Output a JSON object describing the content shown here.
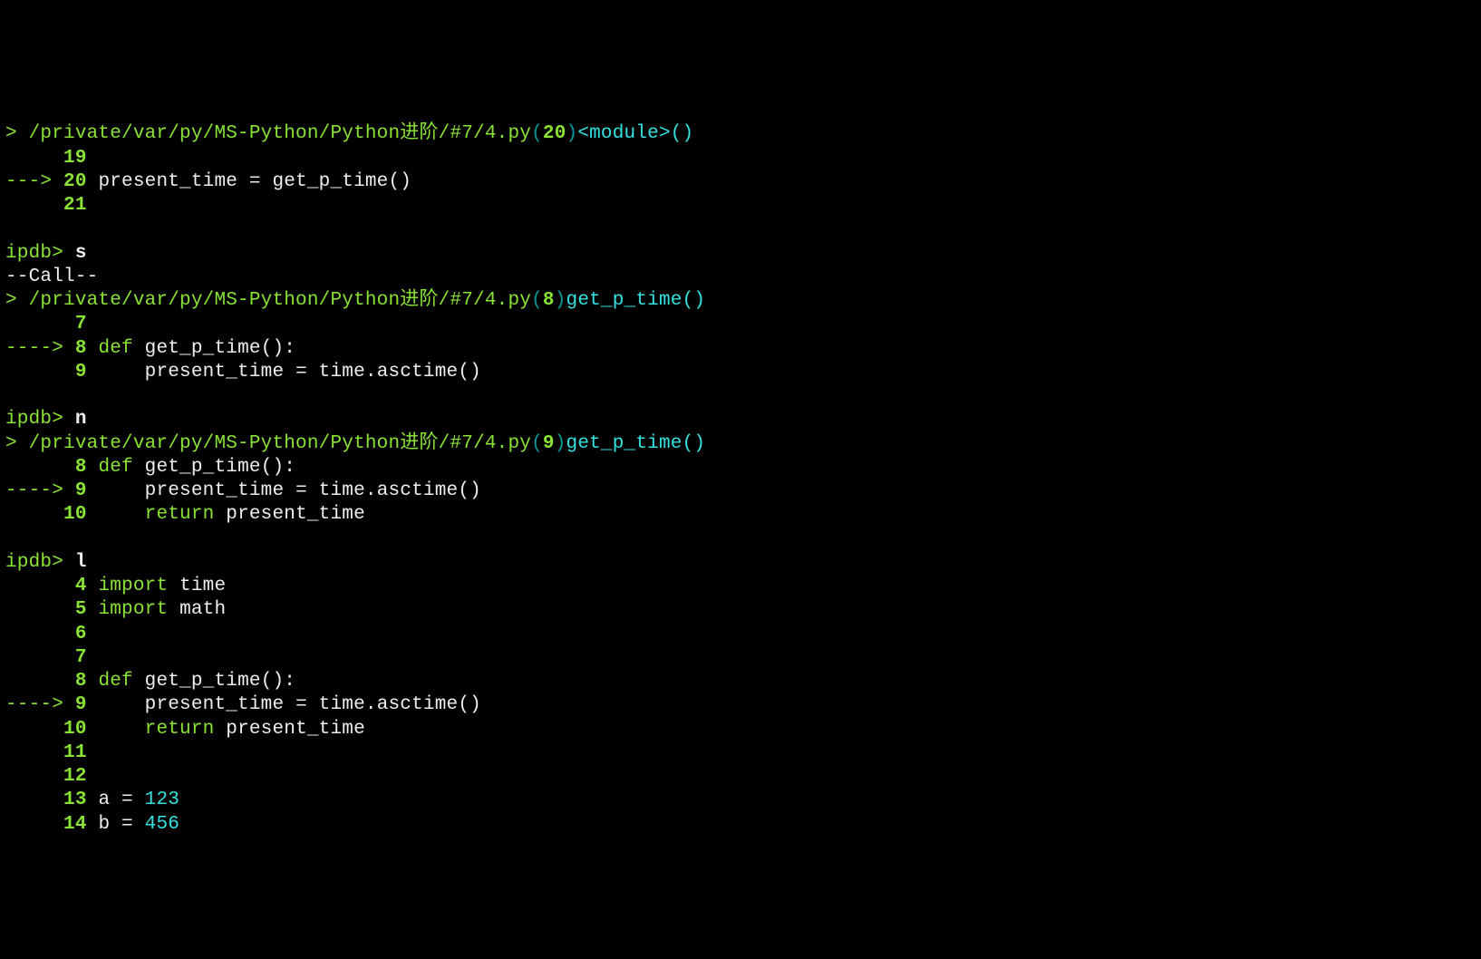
{
  "colors": {
    "green": "#8ae234",
    "cyan": "#34e2e2",
    "teal": "#06989a",
    "white": "#eeeeec",
    "bg": "#000000"
  },
  "file_path": "/private/var/py/MS-Python/Python进阶/#7/4.py",
  "prompt": "ipdb> ",
  "caret": "> ",
  "arrow": "---> ",
  "long_arrow": "----> ",
  "call_marker": "--Call--",
  "paren_open": "(",
  "paren_close": ")",
  "paren_empty": "()",
  "colon": ":",
  "dot": ".",
  "eq": " = ",
  "cmd_s": "s",
  "cmd_n": "n",
  "cmd_l": "l",
  "lineno_20": "20",
  "lineno_8": "8",
  "lineno_9": "9",
  "func_module": "<module>",
  "func_get_p_time": "get_p_time",
  "num_4": "4",
  "num_5": "5",
  "num_6": "6",
  "num_7": "7",
  "num_8": "8",
  "num_9": "9",
  "num_10": "10",
  "num_11": "11",
  "num_12": "12",
  "num_13": "13",
  "num_14": "14",
  "num_19": "19",
  "num_20": "20",
  "num_21": "21",
  "kw_def": "def",
  "kw_import": "import",
  "kw_return": "return",
  "id_present_time": "present_time",
  "id_get_p_time": "get_p_time",
  "id_time": "time",
  "id_math": "math",
  "id_asctime": "asctime",
  "id_a": "a",
  "id_b": "b",
  "val_123": "123",
  "val_456": "456",
  "pad4": "    ",
  "pad5": "     ",
  "pad6": "      ",
  "pad2": "  ",
  "sp": " "
}
